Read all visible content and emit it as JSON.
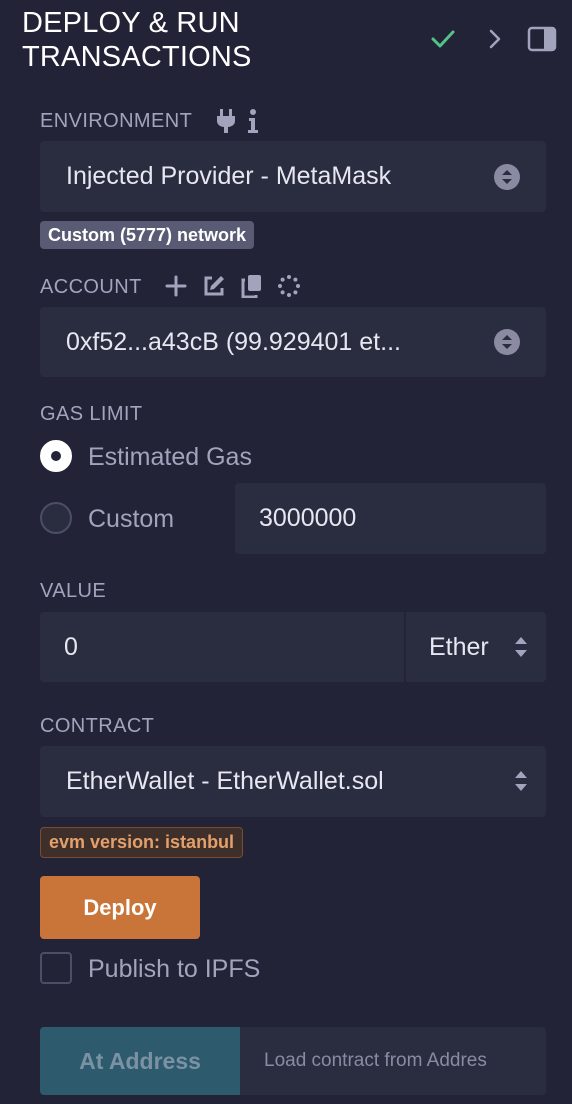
{
  "header": {
    "title": "DEPLOY & RUN TRANSACTIONS"
  },
  "environment": {
    "label": "ENVIRONMENT",
    "selected": "Injected Provider - MetaMask",
    "network_badge": "Custom (5777) network"
  },
  "account": {
    "label": "ACCOUNT",
    "selected": "0xf52...a43cB (99.929401 et..."
  },
  "gas_limit": {
    "label": "GAS LIMIT",
    "options": [
      {
        "label": "Estimated Gas",
        "checked": true
      },
      {
        "label": "Custom",
        "checked": false
      }
    ],
    "custom_value": "3000000"
  },
  "value": {
    "label": "VALUE",
    "amount": "0",
    "unit": "Ether"
  },
  "contract": {
    "label": "CONTRACT",
    "selected": "EtherWallet - EtherWallet.sol",
    "evm_badge": "evm version: istanbul"
  },
  "deploy": {
    "button_label": "Deploy",
    "publish_label": "Publish to IPFS"
  },
  "at_address": {
    "button_label": "At Address",
    "placeholder": "Load contract from Addres"
  },
  "colors": {
    "background": "#222336",
    "field": "#2a2c3f",
    "accent_orange": "#c97539",
    "check_green": "#52c288",
    "at_address_button": "#2e5a6e"
  },
  "icons": {
    "header": [
      "check-icon",
      "chevron-right-icon",
      "panel-toggle-icon"
    ],
    "environment": [
      "plug-icon",
      "info-icon"
    ],
    "account": [
      "plus-icon",
      "edit-icon",
      "copy-icon",
      "spinner-icon"
    ]
  }
}
